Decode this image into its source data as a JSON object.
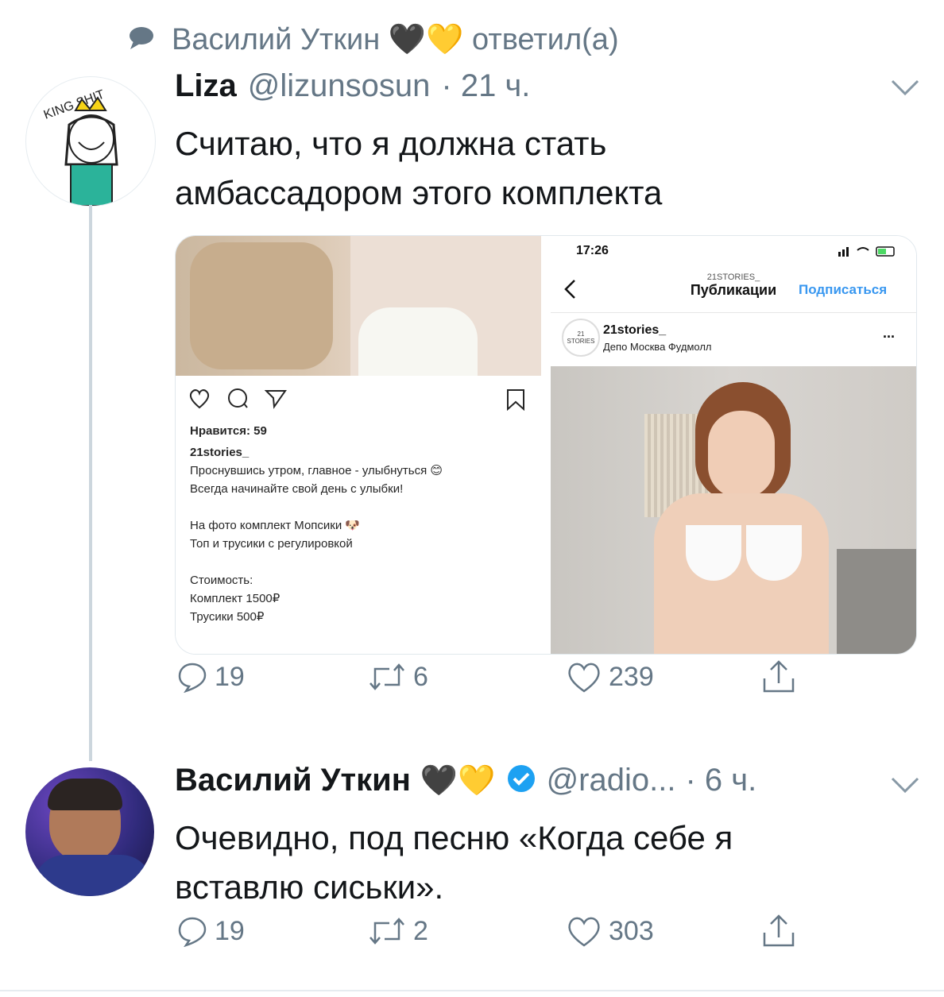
{
  "retweet_context": {
    "text": "Василий Уткин 🖤💛 ответил(а)"
  },
  "tweet1": {
    "name": "Liza",
    "handle": "@lizunsosun",
    "time": "· 21 ч.",
    "text_line1": "Считаю, что я должна стать",
    "text_line2": "амбассадором этого комплекта",
    "avatar_caption": "KING SHIT",
    "actions": {
      "replies": "19",
      "retweets": "6",
      "likes": "239"
    }
  },
  "media": {
    "left": {
      "likes": "Нравится: 59",
      "account": "21stories_",
      "lines": [
        "Проснувшись утром, главное - улыбнуться 😊",
        "Всегда начинайте свой день с улыбки!",
        "",
        "На фото комплект Мопсики 🐶",
        "Топ и трусики с регулировкой",
        "",
        "Стоимость:",
        "Комплект 1500₽",
        "Трусики 500₽"
      ]
    },
    "right": {
      "clock": "17:26",
      "account_small": "21STORIES_",
      "header_title": "Публикации",
      "subscribe": "Подписаться",
      "post_account": "21stories_",
      "post_location": "Депо Москва Фудмолл",
      "avatar_label": "21 STORIES",
      "more": "..."
    }
  },
  "tweet2": {
    "name": "Василий Уткин",
    "emojis": "🖤💛",
    "handle": "@radio...",
    "time": "· 6 ч.",
    "text_line1": "Очевидно, под песню «Когда себе я",
    "text_line2": "вставлю сиськи».",
    "actions": {
      "replies": "19",
      "retweets": "2",
      "likes": "303"
    }
  },
  "colors": {
    "text": "#14171a",
    "grey": "#657786",
    "verified": "#1da1f2",
    "ig_blue": "#3897f0",
    "line": "#ccd6dd"
  }
}
